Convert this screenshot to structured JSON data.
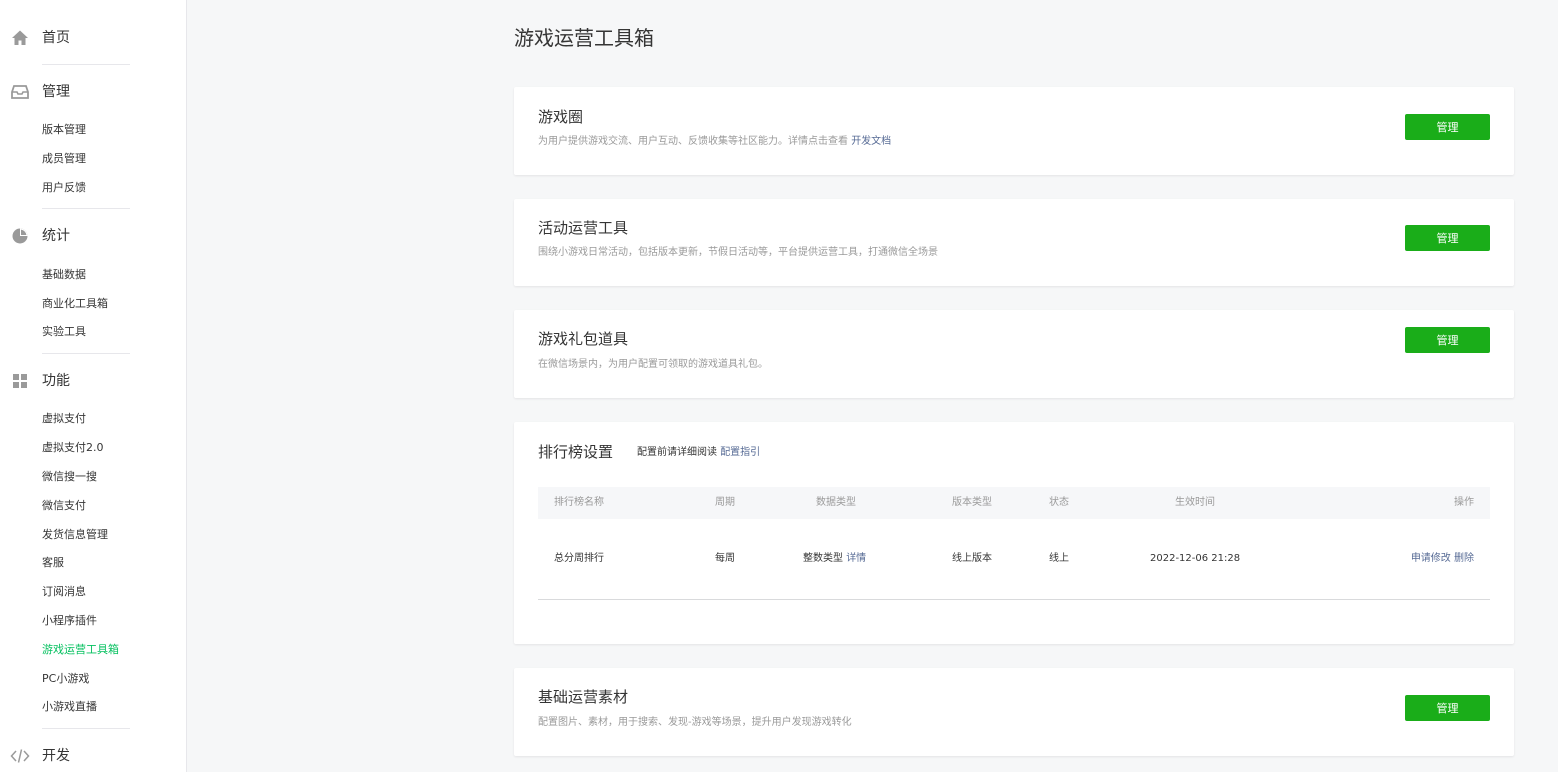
{
  "sidebar": {
    "home": {
      "label": "首页",
      "icon": "home-icon"
    },
    "manage": {
      "label": "管理",
      "icon": "inbox-icon",
      "items": [
        "版本管理",
        "成员管理",
        "用户反馈"
      ]
    },
    "stats": {
      "label": "统计",
      "icon": "pie-chart-icon",
      "items": [
        "基础数据",
        "商业化工具箱",
        "实验工具"
      ]
    },
    "features": {
      "label": "功能",
      "icon": "grid-icon",
      "items": [
        "虚拟支付",
        "虚拟支付2.0",
        "微信搜一搜",
        "微信支付",
        "发货信息管理",
        "客服",
        "订阅消息",
        "小程序插件",
        "游戏运营工具箱",
        "PC小游戏",
        "小游戏直播"
      ],
      "active_index": 8
    },
    "dev": {
      "label": "开发",
      "icon": "code-icon"
    }
  },
  "page": {
    "title": "游戏运营工具箱"
  },
  "cards": {
    "game_circle": {
      "title": "游戏圈",
      "desc": "为用户提供游戏交流、用户互动、反馈收集等社区能力。详情点击查看",
      "link": "开发文档",
      "button": "管理"
    },
    "activity": {
      "title": "活动运营工具",
      "desc": "围绕小游戏日常活动，包括版本更新，节假日活动等，平台提供运营工具，打通微信全场景",
      "button": "管理"
    },
    "gift": {
      "title": "游戏礼包道具",
      "desc": "在微信场景内，为用户配置可领取的游戏道具礼包。",
      "button": "管理"
    },
    "leaderboard": {
      "title": "排行榜设置",
      "hint": "配置前请详细阅读",
      "hint_link": "配置指引",
      "columns": [
        "排行榜名称",
        "周期",
        "数据类型",
        "版本类型",
        "状态",
        "生效时间",
        "操作"
      ],
      "rows": [
        {
          "name": "总分周排行",
          "period": "每周",
          "data_type": "整数类型",
          "detail_link": "详情",
          "version_type": "线上版本",
          "status": "线上",
          "effective_time": "2022-12-06 21:28",
          "action_edit": "申请修改",
          "action_delete": "删除"
        }
      ]
    },
    "materials": {
      "title": "基础运营素材",
      "desc": "配置图片、素材，用于搜索、发现-游戏等场景，提升用户发现游戏转化",
      "button": "管理"
    }
  },
  "colors": {
    "accent_green": "#1aad19",
    "active_nav": "#07c160",
    "link_blue": "#576b95"
  }
}
